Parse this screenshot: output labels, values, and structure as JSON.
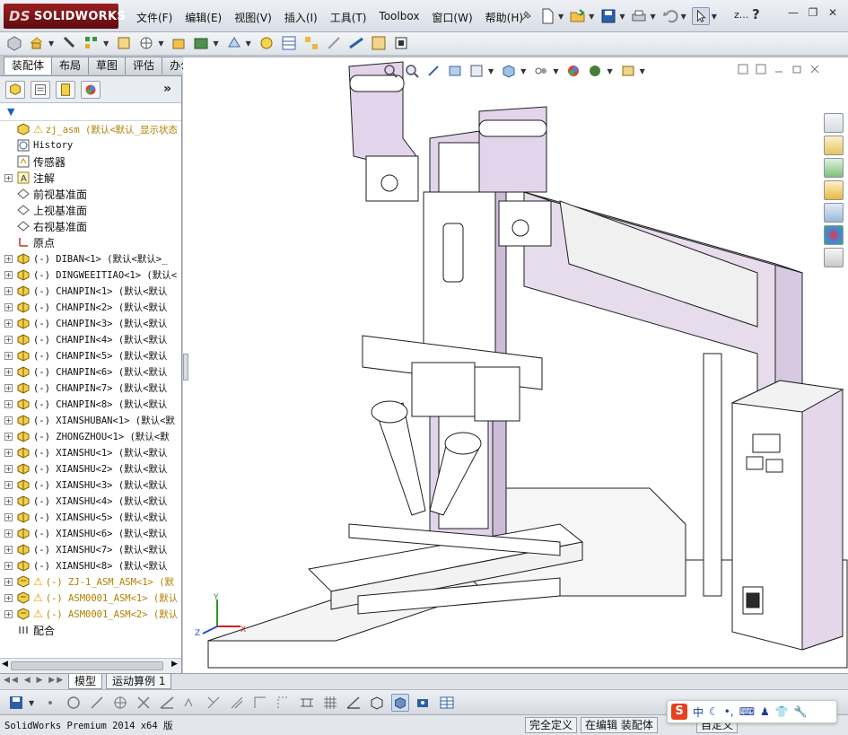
{
  "app": {
    "logo_text": "SOLIDWORKS",
    "logo_prefix": "DS",
    "brand_color": "#8a1a1d"
  },
  "menu": [
    "文件(F)",
    "编辑(E)",
    "视图(V)",
    "插入(I)",
    "工具(T)",
    "Toolbox",
    "窗口(W)",
    "帮助(H)"
  ],
  "titlebar": {
    "search_hint": "z...",
    "help": "?"
  },
  "tabs": [
    {
      "label": "装配体",
      "active": true
    },
    {
      "label": "布局",
      "active": false
    },
    {
      "label": "草图",
      "active": false
    },
    {
      "label": "评估",
      "active": false
    },
    {
      "label": "办公室产品",
      "active": false
    }
  ],
  "feature_manager": {
    "expand_label": "»",
    "tree": [
      {
        "label": "zj_asm  (默认<默认_显示状态",
        "icon": "assembly-icon",
        "warn": true,
        "plus": false,
        "style": "gold"
      },
      {
        "label": "History",
        "icon": "history-icon",
        "plus": false
      },
      {
        "label": "传感器",
        "icon": "sensor-icon",
        "plus": false,
        "style": "sans"
      },
      {
        "label": "注解",
        "icon": "annotation-icon",
        "plus": true,
        "style": "sans"
      },
      {
        "label": "前视基准面",
        "icon": "plane-icon",
        "plus": false,
        "style": "sans"
      },
      {
        "label": "上视基准面",
        "icon": "plane-icon",
        "plus": false,
        "style": "sans"
      },
      {
        "label": "右视基准面",
        "icon": "plane-icon",
        "plus": false,
        "style": "sans"
      },
      {
        "label": "原点",
        "icon": "origin-icon",
        "plus": false,
        "style": "sans"
      },
      {
        "label": "(-) DIBAN<1> (默认<默认>_",
        "icon": "part-icon",
        "plus": true
      },
      {
        "label": "(-) DINGWEEITIAO<1> (默认<",
        "icon": "part-icon",
        "plus": true
      },
      {
        "label": "(-) CHANPIN<1> (默认<默认",
        "icon": "part-icon",
        "plus": true
      },
      {
        "label": "(-) CHANPIN<2> (默认<默认",
        "icon": "part-icon",
        "plus": true
      },
      {
        "label": "(-) CHANPIN<3> (默认<默认",
        "icon": "part-icon",
        "plus": true
      },
      {
        "label": "(-) CHANPIN<4> (默认<默认",
        "icon": "part-icon",
        "plus": true
      },
      {
        "label": "(-) CHANPIN<5> (默认<默认",
        "icon": "part-icon",
        "plus": true
      },
      {
        "label": "(-) CHANPIN<6> (默认<默认",
        "icon": "part-icon",
        "plus": true
      },
      {
        "label": "(-) CHANPIN<7> (默认<默认",
        "icon": "part-icon",
        "plus": true
      },
      {
        "label": "(-) CHANPIN<8> (默认<默认",
        "icon": "part-icon",
        "plus": true
      },
      {
        "label": "(-) XIANSHUBAN<1> (默认<默",
        "icon": "part-icon",
        "plus": true
      },
      {
        "label": "(-) ZHONGZHOU<1> (默认<默",
        "icon": "part-icon",
        "plus": true
      },
      {
        "label": "(-) XIANSHU<1> (默认<默认",
        "icon": "part-icon",
        "plus": true
      },
      {
        "label": "(-) XIANSHU<2> (默认<默认",
        "icon": "part-icon",
        "plus": true
      },
      {
        "label": "(-) XIANSHU<3> (默认<默认",
        "icon": "part-icon",
        "plus": true
      },
      {
        "label": "(-) XIANSHU<4> (默认<默认",
        "icon": "part-icon",
        "plus": true
      },
      {
        "label": "(-) XIANSHU<5> (默认<默认",
        "icon": "part-icon",
        "plus": true
      },
      {
        "label": "(-) XIANSHU<6> (默认<默认",
        "icon": "part-icon",
        "plus": true
      },
      {
        "label": "(-) XIANSHU<7> (默认<默认",
        "icon": "part-icon",
        "plus": true
      },
      {
        "label": "(-) XIANSHU<8> (默认<默认",
        "icon": "part-icon",
        "plus": true
      },
      {
        "label": "(-) ZJ-1_ASM_ASM<1> (默",
        "icon": "subassembly-icon",
        "warn": true,
        "plus": true,
        "style": "gold"
      },
      {
        "label": "(-) ASM0001_ASM<1> (默认",
        "icon": "subassembly-icon",
        "warn": true,
        "plus": true,
        "style": "gold"
      },
      {
        "label": "(-) ASM0001_ASM<2> (默认",
        "icon": "subassembly-icon",
        "warn": true,
        "plus": true,
        "style": "gold"
      },
      {
        "label": "配合",
        "icon": "mates-icon",
        "plus": false,
        "style": "sans"
      }
    ]
  },
  "bottom_tabs": [
    {
      "label": "模型",
      "active": true
    },
    {
      "label": "运动算例 1",
      "active": false
    }
  ],
  "status": {
    "app_version": "SolidWorks Premium 2014 x64 版",
    "fully_defined": "完全定义",
    "editing": "在编辑 装配体",
    "custom": "自定义"
  },
  "ime": {
    "logo": "S",
    "mode": "中"
  },
  "model": {
    "frame_color": "#e6dcec",
    "edge_color": "#1e1e1e",
    "triad_axes": [
      "Y",
      "X",
      "Z"
    ]
  }
}
